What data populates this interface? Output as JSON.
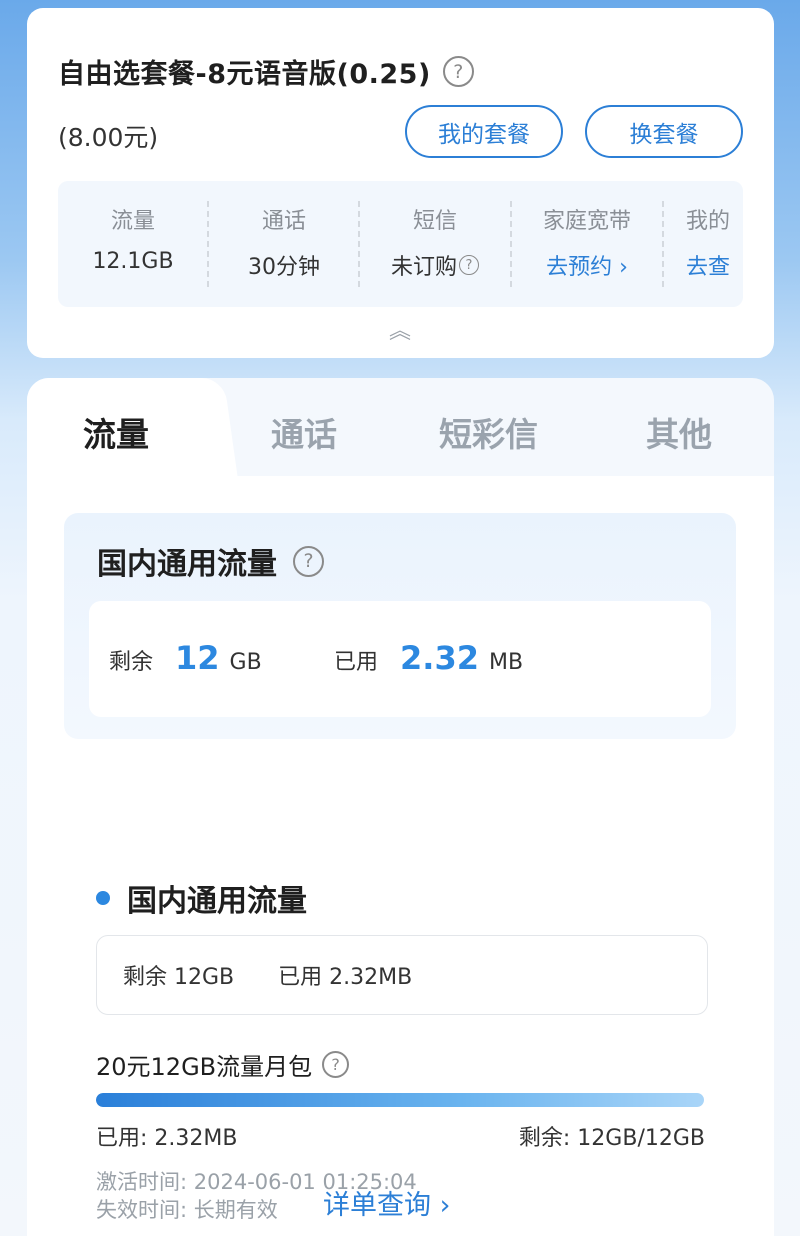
{
  "plan": {
    "title": "自由选套餐-8元语音版(0.25)",
    "price": "(8.00元)",
    "my_plan_button": "我的套餐",
    "switch_plan_button": "换套餐",
    "help_icon": "question-circle-icon",
    "collapse_icon": "double-chevron-up-icon",
    "stats": [
      {
        "label": "流量",
        "value": "12.1GB"
      },
      {
        "label": "通话",
        "value": "30分钟"
      },
      {
        "label": "短信",
        "value": "未订购"
      },
      {
        "label": "家庭宽带",
        "value": "去预约 ›"
      },
      {
        "label": "我的",
        "value": "去查"
      }
    ]
  },
  "tabs": [
    "流量",
    "通话",
    "短彩信",
    "其他"
  ],
  "active_tab": "流量",
  "summary": {
    "title": "国内通用流量",
    "remain_label": "剩余",
    "remain_value": "12",
    "remain_unit": "GB",
    "used_label": "已用",
    "used_value": "2.32",
    "used_unit": "MB"
  },
  "section": {
    "title": "国内通用流量",
    "remain_text": "剩余 12GB",
    "used_text": "已用 2.32MB"
  },
  "package": {
    "name": "20元12GB流量月包",
    "used_fraction": 0.9998,
    "used_text": "已用:  2.32MB",
    "remain_text": "剩余:  12GB/12GB",
    "activated_text": "激活时间:  2024-06-01 01:25:04",
    "expire_text": "失效时间:  长期有效"
  },
  "detail_link": "详单查询 ›",
  "colors": {
    "accent": "#2c88e0",
    "button_border": "#2c7fd6",
    "background_top": "#6aa9ea"
  }
}
